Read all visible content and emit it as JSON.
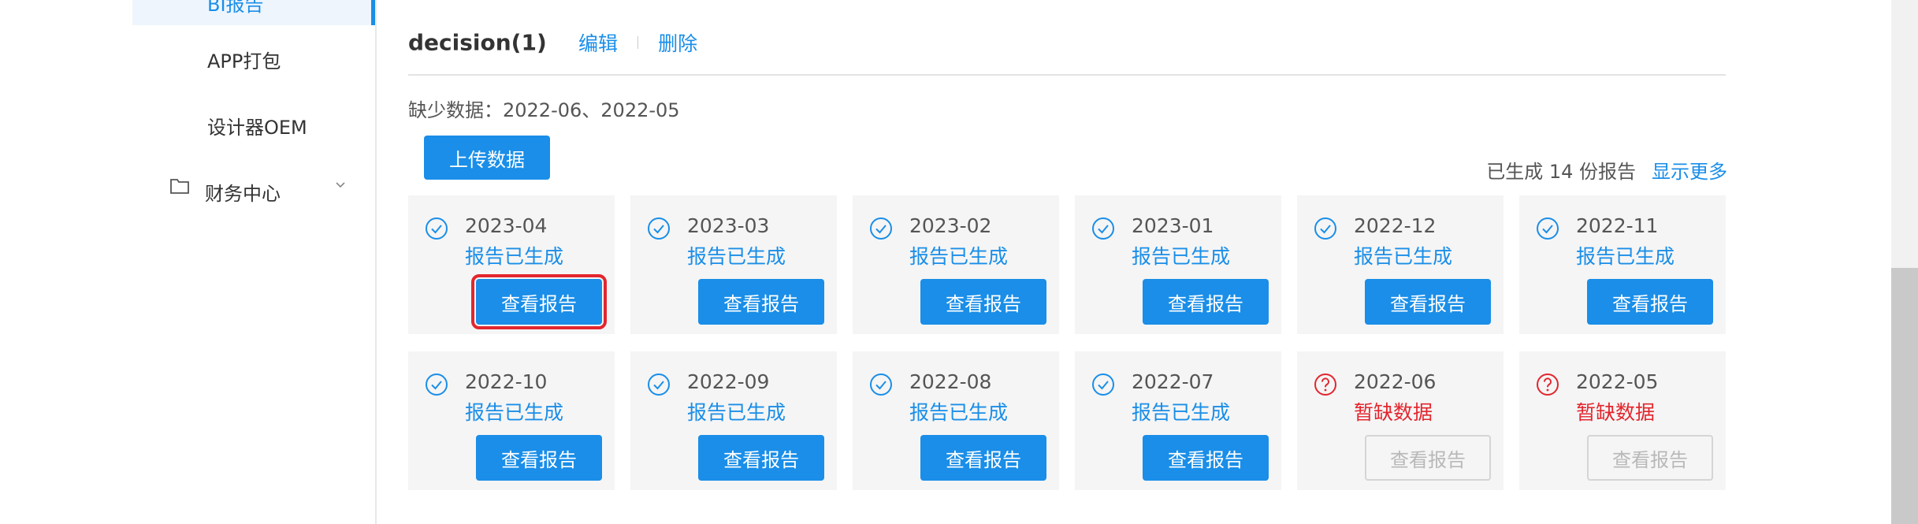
{
  "sidebar": {
    "active_item": "BI报告",
    "items": [
      {
        "label": "APP打包"
      },
      {
        "label": "设计器OEM"
      },
      {
        "label": "财务中心"
      }
    ]
  },
  "header": {
    "title": "decision(1)",
    "edit_label": "编辑",
    "delete_label": "删除"
  },
  "missing_text": "缺少数据：2022-06、2022-05",
  "upload_label": "上传数据",
  "summary": {
    "generated_text": "已生成 14 份报告",
    "show_more_label": "显示更多"
  },
  "view_label": "查看报告",
  "colors": {
    "accent": "#1a8ee8",
    "error": "#e3262e"
  },
  "cards": [
    {
      "month": "2023-04",
      "status": "报告已生成",
      "state": "ok"
    },
    {
      "month": "2023-03",
      "status": "报告已生成",
      "state": "ok"
    },
    {
      "month": "2023-02",
      "status": "报告已生成",
      "state": "ok"
    },
    {
      "month": "2023-01",
      "status": "报告已生成",
      "state": "ok"
    },
    {
      "month": "2022-12",
      "status": "报告已生成",
      "state": "ok"
    },
    {
      "month": "2022-11",
      "status": "报告已生成",
      "state": "ok"
    },
    {
      "month": "2022-10",
      "status": "报告已生成",
      "state": "ok"
    },
    {
      "month": "2022-09",
      "status": "报告已生成",
      "state": "ok"
    },
    {
      "month": "2022-08",
      "status": "报告已生成",
      "state": "ok"
    },
    {
      "month": "2022-07",
      "status": "报告已生成",
      "state": "ok"
    },
    {
      "month": "2022-06",
      "status": "暂缺数据",
      "state": "missing"
    },
    {
      "month": "2022-05",
      "status": "暂缺数据",
      "state": "missing"
    }
  ]
}
